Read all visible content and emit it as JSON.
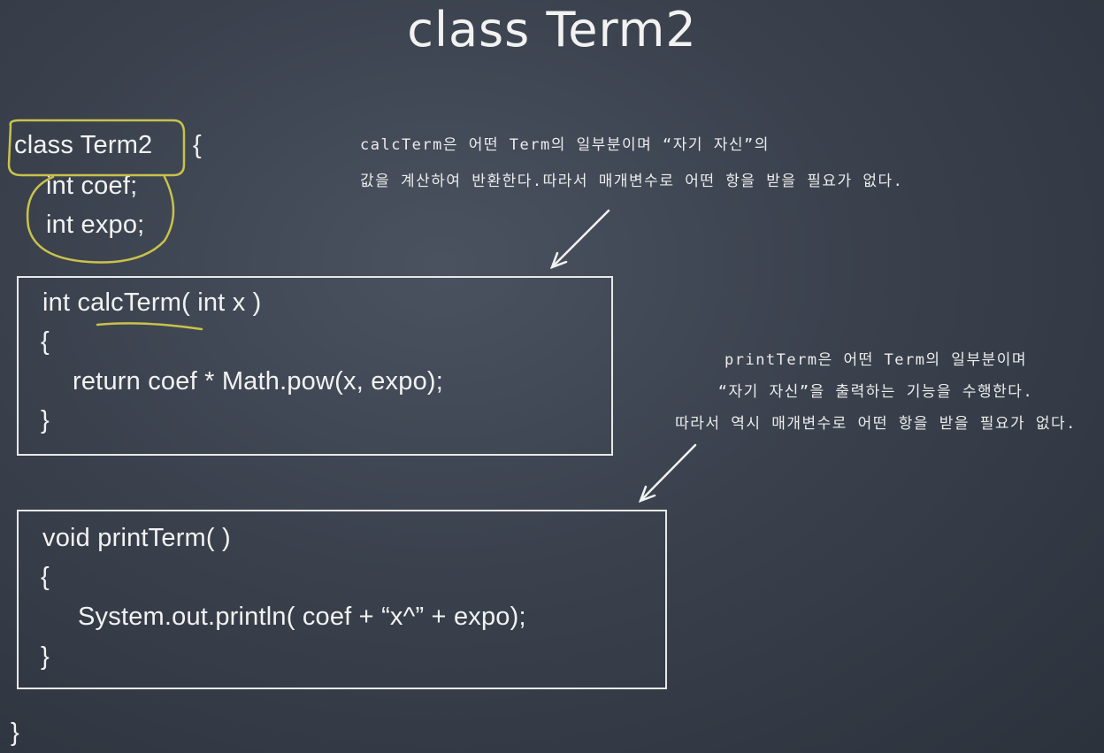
{
  "slide": {
    "title": "class Term2",
    "class_header": {
      "keyword": "class Term2",
      "brace": "{"
    },
    "fields": [
      "int coef;",
      "int expo;"
    ],
    "calc_method": {
      "signature": "int calcTerm( int x )",
      "open_brace": "{",
      "body": "return coef * Math.pow(x, expo);",
      "close_brace": "}"
    },
    "print_method": {
      "signature": "void printTerm( )",
      "open_brace": "{",
      "body": "System.out.println( coef + “x^” + expo);",
      "close_brace": "}"
    },
    "class_close": "}",
    "note_calc": [
      "calcTerm은 어떤 Term의 일부분이며 “자기 자신”의",
      "값을 계산하여 반환한다.따라서 매개변수로 어떤 항을 받을 필요가 없다."
    ],
    "note_print": [
      "printTerm은 어떤 Term의 일부분이며",
      "“자기 자신”을 출력하는 기능을 수행한다.",
      "따라서 역시 매개변수로 어떤 항을 받을 필요가 없다."
    ],
    "colors": {
      "highlight": "#c9c24a",
      "chalk": "#f2f2f2",
      "board": "#3a414d"
    }
  }
}
